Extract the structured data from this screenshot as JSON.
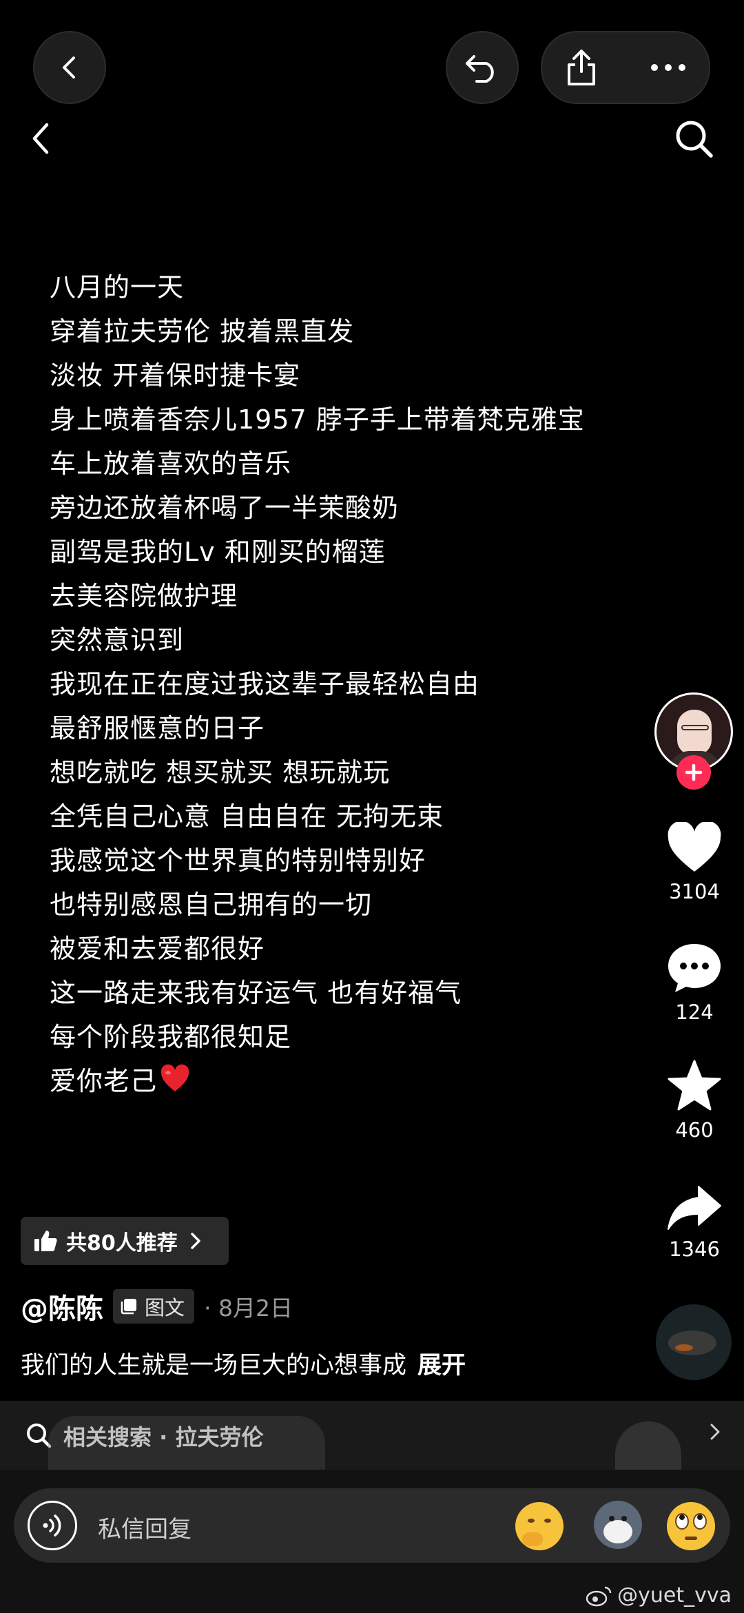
{
  "top_bar": {
    "back_icon": "chevron-left-icon",
    "undo_icon": "undo-arrow-icon",
    "share_icon": "share-upload-icon",
    "more_icon": "more-dots-icon",
    "nav_back_icon": "chevron-left-icon",
    "search_icon": "search-icon"
  },
  "post": {
    "lines": [
      "八月的一天",
      "穿着拉夫劳伦 披着黑直发",
      "淡妆 开着保时捷卡宴",
      "身上喷着香奈儿1957 脖子手上带着梵克雅宝",
      "车上放着喜欢的音乐",
      "旁边还放着杯喝了一半茉酸奶",
      "副驾是我的Lv 和刚买的榴莲",
      "去美容院做护理",
      "突然意识到",
      "我现在正在度过我这辈子最轻松自由",
      "最舒服惬意的日子",
      "想吃就吃 想买就买 想玩就玩",
      "全凭自己心意 自由自在 无拘无束",
      "我感觉这个世界真的特别特别好",
      "也特别感恩自己拥有的一切",
      "被爱和去爱都很好",
      "这一路走来我有好运气 也有好福气",
      "每个阶段我都很知足",
      "爱你老己"
    ],
    "last_line_emoji": "red-heart-emoji"
  },
  "sidebar": {
    "avatar_follow_icon": "plus-icon",
    "likes": "3104",
    "comments": "124",
    "favorites": "460",
    "shares": "1346"
  },
  "recommend": {
    "label": "共80人推荐"
  },
  "author": {
    "name": "@陈陈",
    "tag": "图文",
    "date": "· 8月2日"
  },
  "caption": {
    "text": "我们的人生就是一场巨大的心想事成",
    "expand": "展开"
  },
  "related_search": {
    "label": "相关搜索 · 拉夫劳伦"
  },
  "reply": {
    "placeholder": "私信回复"
  },
  "watermark": "@yuet_vva",
  "colors": {
    "background": "#000000",
    "follow_badge": "#fe2c55",
    "heart_emoji": "#e8232e"
  }
}
